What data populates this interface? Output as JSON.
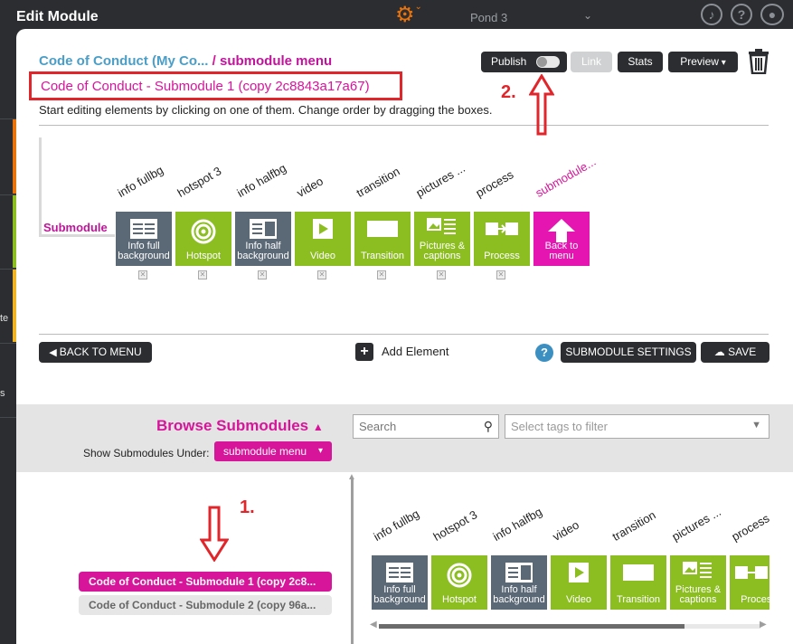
{
  "window": {
    "title": "Edit Module",
    "pond": "Pond 3"
  },
  "colors": {
    "accent": "#d6159a",
    "crumb": "#4a9ec7",
    "dark": "#2b2d30",
    "annotation": "#e0252b",
    "slate": "#5b6876",
    "green": "#8cbe22",
    "pink": "#e415b0",
    "gray_pill": "#e6e6e6"
  },
  "sidebar": {
    "frag1": "te",
    "frag2": "s"
  },
  "header": {
    "crumb_parent": "Code of Conduct (My Co...",
    "crumb_sep": "/",
    "crumb_child": "submodule menu",
    "submodule_title": "Code of Conduct - Submodule 1 (copy 2c8843a17a67)",
    "hint": "Start editing elements by clicking on one of them. Change order by dragging the boxes."
  },
  "toolbar": {
    "publish": "Publish",
    "link": "Link",
    "stats": "Stats",
    "preview": "Preview"
  },
  "annotations": {
    "step1": "1.",
    "step2": "2."
  },
  "rail": {
    "label": "Submodule",
    "labels": [
      "info fullbg",
      "hotspot 3",
      "info halfbg",
      "video",
      "transition",
      "pictures ...",
      "process",
      "submodule..."
    ],
    "tiles": [
      {
        "caption": "Info full background",
        "icon": "info-full-icon"
      },
      {
        "caption": "Hotspot",
        "icon": "hotspot-icon"
      },
      {
        "caption": "Info half background",
        "icon": "info-half-icon"
      },
      {
        "caption": "Video",
        "icon": "video-icon"
      },
      {
        "caption": "Transition",
        "icon": "transition-icon"
      },
      {
        "caption": "Pictures & captions",
        "icon": "pictures-icon"
      },
      {
        "caption": "Process",
        "icon": "process-icon"
      },
      {
        "caption": "Back to menu",
        "icon": "back-arrow-icon"
      }
    ]
  },
  "actions": {
    "back": "BACK TO MENU",
    "add": "Add Element",
    "settings": "SUBMODULE SETTINGS",
    "save": "SAVE"
  },
  "browse": {
    "title": "Browse Submodules",
    "show_label": "Show Submodules Under:",
    "show_value": "submodule menu",
    "search_placeholder": "Search",
    "tags_placeholder": "Select tags to filter",
    "items": [
      "Code of Conduct - Submodule 1 (copy 2c8...",
      "Code of Conduct - Submodule 2 (copy 96a..."
    ]
  },
  "preview_rail": {
    "labels": [
      "info fullbg",
      "hotspot 3",
      "info halfbg",
      "video",
      "transition",
      "pictures ...",
      "process"
    ],
    "tiles": [
      "Info full background",
      "Hotspot",
      "Info half background",
      "Video",
      "Transition",
      "Pictures & captions",
      "Process"
    ]
  }
}
